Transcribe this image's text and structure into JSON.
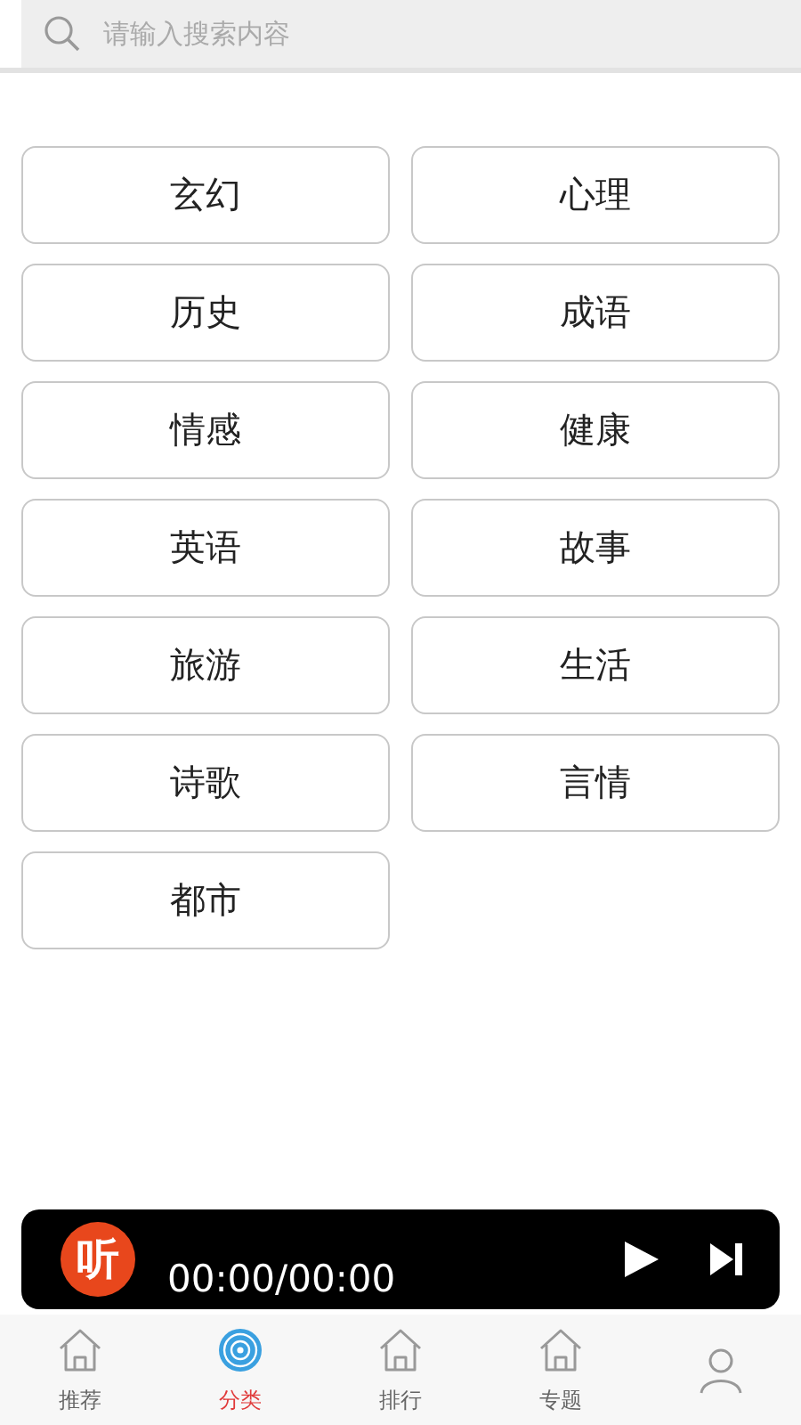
{
  "search": {
    "placeholder": "请输入搜索内容"
  },
  "categories": [
    {
      "label": "玄幻"
    },
    {
      "label": "心理"
    },
    {
      "label": "历史"
    },
    {
      "label": "成语"
    },
    {
      "label": "情感"
    },
    {
      "label": "健康"
    },
    {
      "label": "英语"
    },
    {
      "label": "故事"
    },
    {
      "label": "旅游"
    },
    {
      "label": "生活"
    },
    {
      "label": "诗歌"
    },
    {
      "label": "言情"
    },
    {
      "label": "都市"
    }
  ],
  "player": {
    "logo": "听",
    "time": "00:00/00:00"
  },
  "tabs": [
    {
      "label": "推荐",
      "kind": "home",
      "selected": false
    },
    {
      "label": "分类",
      "kind": "disc",
      "selected": true
    },
    {
      "label": "排行",
      "kind": "home",
      "selected": false
    },
    {
      "label": "专题",
      "kind": "home",
      "selected": false
    },
    {
      "kind": "person",
      "selected": false
    }
  ]
}
